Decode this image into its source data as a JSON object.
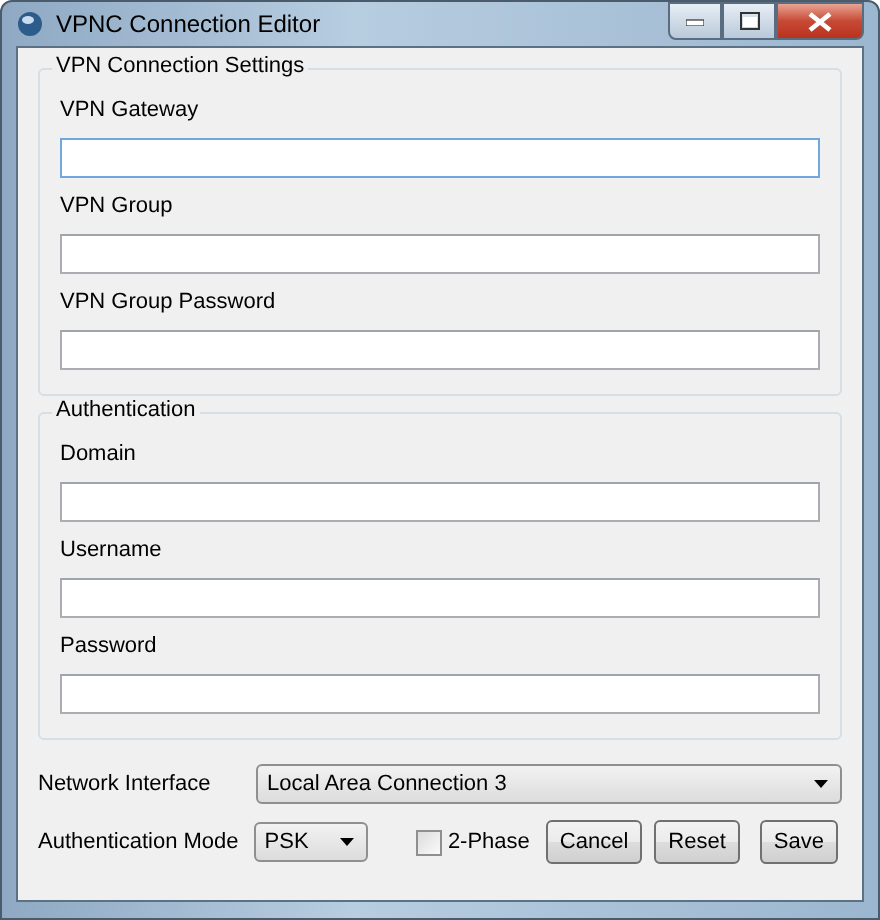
{
  "window": {
    "title": "VPNC Connection Editor"
  },
  "groups": [
    {
      "title": "VPN Connection Settings",
      "fields": [
        {
          "label": "VPN Gateway",
          "focused": true
        },
        {
          "label": "VPN Group",
          "focused": false
        },
        {
          "label": "VPN Group Password",
          "focused": false
        }
      ]
    },
    {
      "title": "Authentication",
      "fields": [
        {
          "label": "Domain",
          "focused": false
        },
        {
          "label": "Username",
          "focused": false
        },
        {
          "label": "Password",
          "focused": false
        }
      ]
    }
  ],
  "network_interface": {
    "label": "Network Interface",
    "value": "Local Area Connection 3"
  },
  "authentication_mode": {
    "label": "Authentication Mode",
    "value": "PSK"
  },
  "two_phase": {
    "label": "2-Phase",
    "checked": false
  },
  "buttons": [
    "Cancel",
    "Reset",
    "Save"
  ]
}
